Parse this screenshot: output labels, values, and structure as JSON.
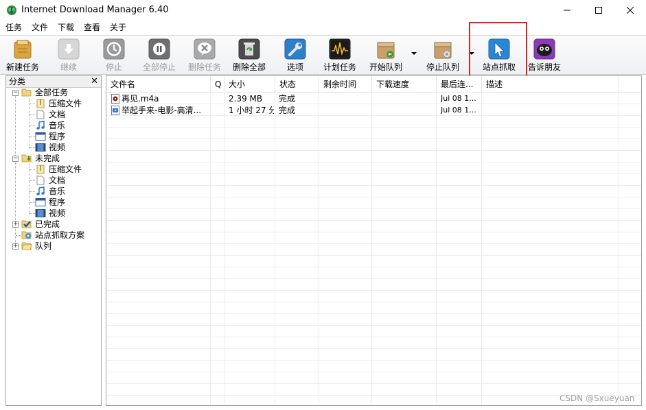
{
  "window": {
    "title": "Internet Download Manager 6.40",
    "controls": {
      "minimize": "—",
      "maximize": "☐",
      "close": "✕"
    }
  },
  "menu": [
    "任务",
    "文件",
    "下载",
    "查看",
    "关于"
  ],
  "toolbar": {
    "buttons": [
      {
        "label": "新建任务",
        "icon": "new-task-icon",
        "enabled": true
      },
      {
        "label": "继续",
        "icon": "resume-icon",
        "enabled": false
      },
      {
        "label": "停止",
        "icon": "stop-icon",
        "enabled": false
      },
      {
        "label": "全部停止",
        "icon": "stop-all-icon",
        "enabled": false
      },
      {
        "label": "删除任务",
        "icon": "delete-task-icon",
        "enabled": false
      },
      {
        "label": "删除全部",
        "icon": "delete-all-icon",
        "enabled": true
      },
      {
        "label": "选项",
        "icon": "options-icon",
        "enabled": true
      },
      {
        "label": "计划任务",
        "icon": "scheduler-icon",
        "enabled": true
      },
      {
        "label": "开始队列",
        "icon": "start-queue-icon",
        "enabled": true
      },
      {
        "label": "停止队列",
        "icon": "stop-queue-icon",
        "enabled": true
      },
      {
        "label": "站点抓取",
        "icon": "site-grabber-icon",
        "enabled": true
      },
      {
        "label": "告诉朋友",
        "icon": "tell-friend-icon",
        "enabled": true
      }
    ],
    "highlight_color": "#e0201c"
  },
  "tree": {
    "header": "分类",
    "close_glyph": "✕",
    "items": {
      "all": "全部任务",
      "all_compressed": "压缩文件",
      "all_docs": "文档",
      "all_music": "音乐",
      "all_programs": "程序",
      "all_video": "视频",
      "unfinished": "未完成",
      "unf_compressed": "压缩文件",
      "unf_docs": "文档",
      "unf_music": "音乐",
      "unf_programs": "程序",
      "unf_video": "视频",
      "finished": "已完成",
      "grabber": "站点抓取方案",
      "queues": "队列"
    }
  },
  "list": {
    "columns": [
      "文件名",
      "Q",
      "大小",
      "状态",
      "剩余时间",
      "下载速度",
      "最后连...",
      "描述"
    ],
    "rows": [
      {
        "icon": "audio-file-icon",
        "name": "再见.m4a",
        "q": "",
        "size": "2.39  MB",
        "status": "完成",
        "remaining": "",
        "speed": "",
        "last": "Jul 08 1...",
        "desc": ""
      },
      {
        "icon": "video-file-icon",
        "name": "举起手来-电影-高清...",
        "q": "",
        "size": "1 小时 27 分",
        "status": "完成",
        "remaining": "",
        "speed": "",
        "last": "Jul 08 1...",
        "desc": ""
      }
    ]
  },
  "watermark": "CSDN @Sxueyuan"
}
